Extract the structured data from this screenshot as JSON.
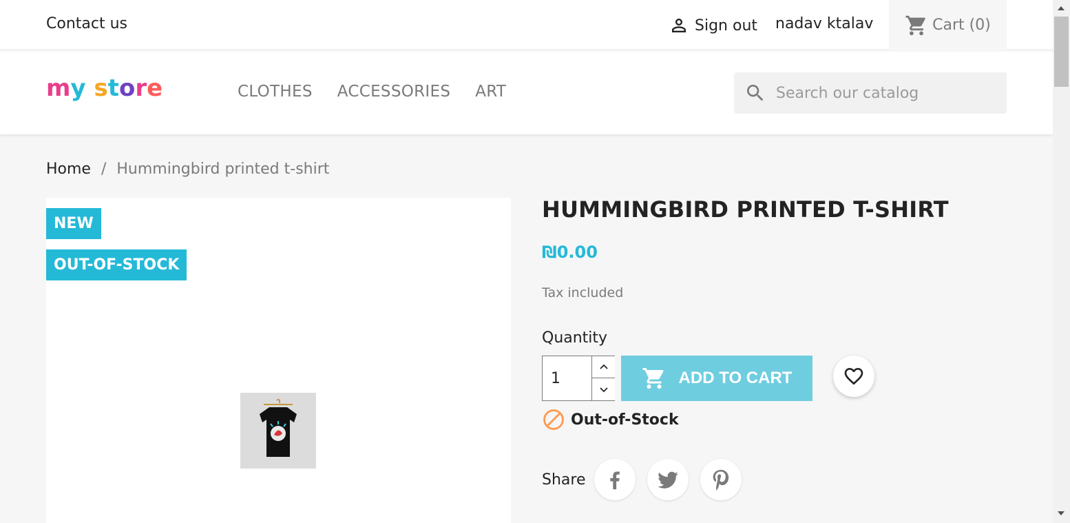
{
  "topbar": {
    "contact_label": "Contact us",
    "signout_label": "Sign out",
    "username": "nadav ktalav",
    "cart_label": "Cart",
    "cart_count": "(0)"
  },
  "header": {
    "logo_text": "my store",
    "menu": [
      "CLOTHES",
      "ACCESSORIES",
      "ART"
    ],
    "search_placeholder": "Search our catalog"
  },
  "breadcrumb": {
    "home": "Home",
    "separator": "/",
    "current": "Hummingbird printed t-shirt"
  },
  "product": {
    "flags": [
      "NEW",
      "OUT-OF-STOCK"
    ],
    "title": "HUMMINGBIRD PRINTED T-SHIRT",
    "price": "₪0.00",
    "tax_label": "Tax included",
    "quantity_label": "Quantity",
    "quantity_value": "1",
    "add_to_cart_label": "ADD TO CART",
    "availability": "Out-of-Stock",
    "share_label": "Share"
  },
  "colors": {
    "accent": "#24b9d7",
    "button": "#6fcde0",
    "warning": "#ff9a52"
  },
  "icons": {
    "user": "person-icon",
    "cart": "shopping-cart-icon",
    "search": "search-icon",
    "wishlist": "heart-icon",
    "availability": "block-icon",
    "social": [
      "facebook-icon",
      "twitter-icon",
      "pinterest-icon"
    ]
  }
}
